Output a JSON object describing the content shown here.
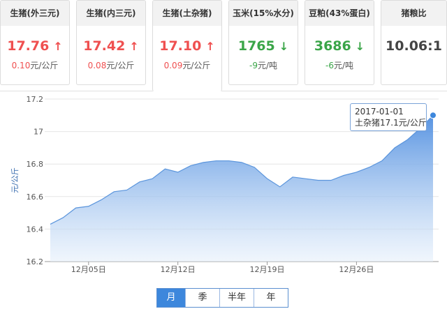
{
  "tabs": [
    {
      "title": "生猪(外三元)",
      "price": "17.76",
      "arrow": "↑",
      "trend": "up",
      "change": "0.10元/公斤",
      "active": false
    },
    {
      "title": "生猪(内三元)",
      "price": "17.42",
      "arrow": "↑",
      "trend": "up",
      "change": "0.08元/公斤",
      "active": false
    },
    {
      "title": "生猪(土杂猪)",
      "price": "17.10",
      "arrow": "↑",
      "trend": "up",
      "change": "0.09元/公斤",
      "active": true
    },
    {
      "title": "玉米(15%水分)",
      "price": "1765",
      "arrow": "↓",
      "trend": "down",
      "change": "-9元/吨",
      "active": false
    },
    {
      "title": "豆粕(43%蛋白)",
      "price": "3686",
      "arrow": "↓",
      "trend": "down",
      "change": "-6元/吨",
      "active": false
    },
    {
      "title": "猪粮比",
      "price": "10.06:1",
      "arrow": "",
      "trend": "flat",
      "change": "",
      "active": false
    }
  ],
  "tooltip": {
    "date": "2017-01-01",
    "text": "土杂猪17.1元/公斤"
  },
  "period_buttons": [
    {
      "label": "月",
      "active": true
    },
    {
      "label": "季",
      "active": false
    },
    {
      "label": "半年",
      "active": false
    },
    {
      "label": "年",
      "active": false
    }
  ],
  "colors": {
    "up": "#ef5050",
    "down": "#3aa548",
    "accent": "#3d87dc",
    "line": "#5b95dc"
  },
  "chart_data": {
    "type": "area",
    "ylabel": "元/公斤",
    "ylim": [
      16.2,
      17.2
    ],
    "yticks": [
      "16.2",
      "16.4",
      "16.6",
      "16.8",
      "17",
      "17.2"
    ],
    "xtick_labels": [
      "12月05日",
      "12月12日",
      "12月19日",
      "12月26日"
    ],
    "xtick_dates": [
      "12-05",
      "12-12",
      "12-19",
      "12-26"
    ],
    "grid": true,
    "series": [
      {
        "x": [
          "12-02",
          "12-03",
          "12-04",
          "12-05",
          "12-06",
          "12-07",
          "12-08",
          "12-09",
          "12-10",
          "12-11",
          "12-12",
          "12-13",
          "12-14",
          "12-15",
          "12-16",
          "12-17",
          "12-18",
          "12-19",
          "12-20",
          "12-21",
          "12-22",
          "12-23",
          "12-24",
          "12-25",
          "12-26",
          "12-27",
          "12-28",
          "12-29",
          "12-30",
          "12-31",
          "01-01"
        ],
        "values": [
          16.43,
          16.47,
          16.53,
          16.54,
          16.58,
          16.63,
          16.64,
          16.69,
          16.71,
          16.77,
          16.75,
          16.79,
          16.81,
          16.82,
          16.82,
          16.81,
          16.78,
          16.71,
          16.66,
          16.72,
          16.71,
          16.7,
          16.7,
          16.73,
          16.75,
          16.78,
          16.82,
          16.9,
          16.95,
          17.02,
          17.1
        ]
      }
    ]
  }
}
